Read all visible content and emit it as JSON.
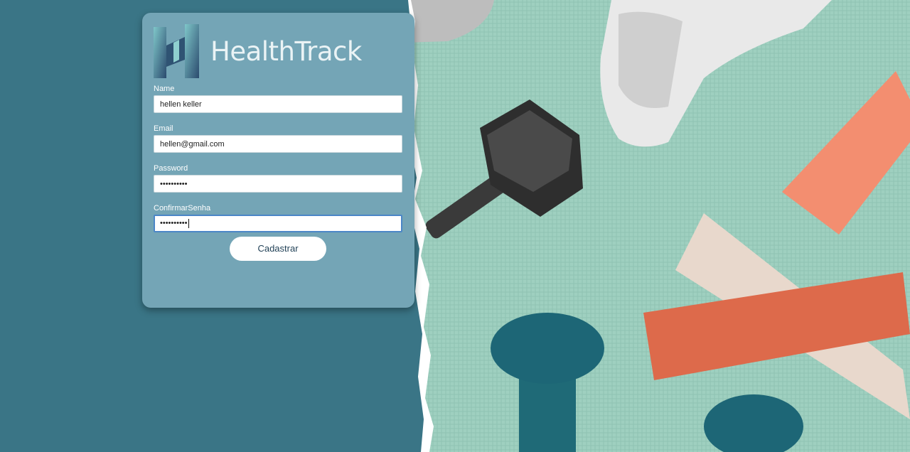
{
  "brand": {
    "name": "HealthTrack"
  },
  "form": {
    "fields": [
      {
        "label": "Name",
        "value": "hellen keller"
      },
      {
        "label": "Email",
        "value": "hellen@gmail.com"
      },
      {
        "label": "Password",
        "value": "••••••••••"
      },
      {
        "label": "ConfirmarSenha",
        "value": "••••••••••"
      }
    ],
    "submit_label": "Cadastrar"
  },
  "colors": {
    "background": "#3a7586",
    "card": "#74a5b6",
    "accent": "#4b86c7",
    "mat": "#9fd0c0"
  },
  "photo": {
    "subject": "fitness-equipment-photo"
  }
}
